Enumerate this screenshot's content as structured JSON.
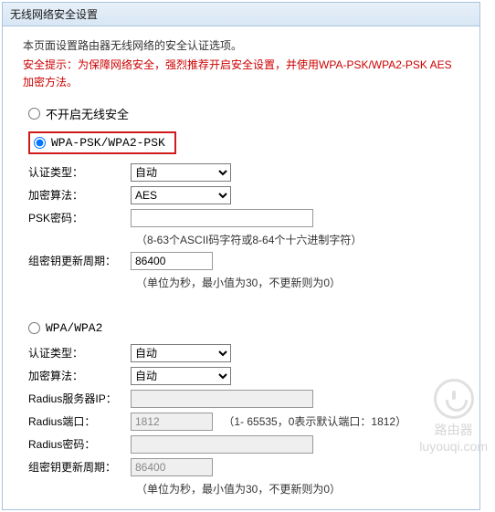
{
  "header": {
    "title": "无线网络安全设置"
  },
  "intro": {
    "desc": "本页面设置路由器无线网络的安全认证选项。",
    "warning": "安全提示：为保障网络安全，强烈推荐开启安全设置，并使用WPA-PSK/WPA2-PSK AES加密方法。"
  },
  "options": {
    "disable": {
      "label": "不开启无线安全",
      "checked": false
    },
    "wpapsk": {
      "label": "WPA-PSK/WPA2-PSK",
      "checked": true,
      "auth_label": "认证类型：",
      "auth_values": [
        "自动"
      ],
      "auth_selected": "自动",
      "enc_label": "加密算法：",
      "enc_values": [
        "AES"
      ],
      "enc_selected": "AES",
      "psk_label": "PSK密码：",
      "psk_value": "",
      "psk_hint": "（8-63个ASCII码字符或8-64个十六进制字符）",
      "rekey_label": "组密钥更新周期：",
      "rekey_value": "86400",
      "rekey_hint": "（单位为秒，最小值为30，不更新则为0）"
    },
    "wpa": {
      "label": "WPA/WPA2",
      "checked": false,
      "auth_label": "认证类型：",
      "auth_values": [
        "自动"
      ],
      "auth_selected": "自动",
      "enc_label": "加密算法：",
      "enc_values": [
        "自动"
      ],
      "enc_selected": "自动",
      "radius_ip_label": "Radius服务器IP：",
      "radius_ip_value": "",
      "radius_port_label": "Radius端口：",
      "radius_port_value": "1812",
      "radius_port_hint": "（1- 65535，0表示默认端口：1812）",
      "radius_pwd_label": "Radius密码：",
      "radius_pwd_value": "",
      "rekey_label": "组密钥更新周期：",
      "rekey_value": "86400",
      "rekey_hint": "（单位为秒，最小值为30，不更新则为0）"
    }
  },
  "watermark": {
    "text1": "路由器",
    "text2": "luyouqi.com"
  }
}
